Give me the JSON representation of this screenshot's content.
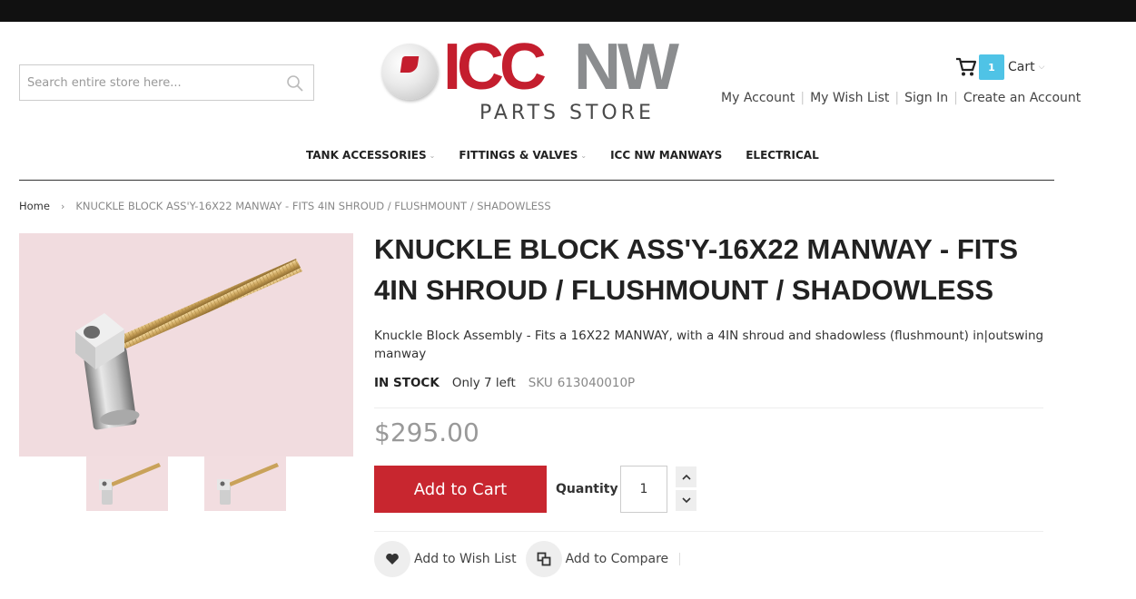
{
  "search": {
    "placeholder": "Search entire store here..."
  },
  "logo": {
    "brand_red": "ICC",
    "brand_gray": "NW",
    "subtitle": "PARTS STORE",
    "colors": {
      "red": "#c41e2e",
      "gray": "#8b8d8f"
    }
  },
  "cart": {
    "count": "1",
    "label": "Cart"
  },
  "account_links": [
    "My Account",
    "My Wish List",
    "Sign In",
    "Create an Account"
  ],
  "nav": [
    {
      "label": "TANK ACCESSORIES",
      "dropdown": true
    },
    {
      "label": "FITTINGS & VALVES",
      "dropdown": true
    },
    {
      "label": "ICC NW MANWAYS",
      "dropdown": false
    },
    {
      "label": "ELECTRICAL",
      "dropdown": false
    }
  ],
  "breadcrumb": {
    "home": "Home",
    "current": "KNUCKLE BLOCK ASS'Y-16X22 MANWAY - FITS 4IN SHROUD / FLUSHMOUNT / SHADOWLESS"
  },
  "product": {
    "title": "KNUCKLE BLOCK ASS'Y-16X22 MANWAY - FITS 4IN SHROUD / FLUSHMOUNT / SHADOWLESS",
    "description": "Knuckle Block Assembly - Fits a 16X22 MANWAY, with a 4IN shroud and shadowless (flushmount) in|outswing manway",
    "stock": "IN STOCK",
    "only_left": "Only 7 left",
    "sku_label": "SKU",
    "sku": "613040010P",
    "price": "$295.00",
    "add_to_cart": "Add to Cart",
    "quantity_label": "Quantity",
    "quantity": "1",
    "wishlist": "Add to Wish List",
    "compare": "Add to Compare"
  },
  "colors": {
    "accent": "#c8262f",
    "cart_badge": "#4fc3e6"
  }
}
